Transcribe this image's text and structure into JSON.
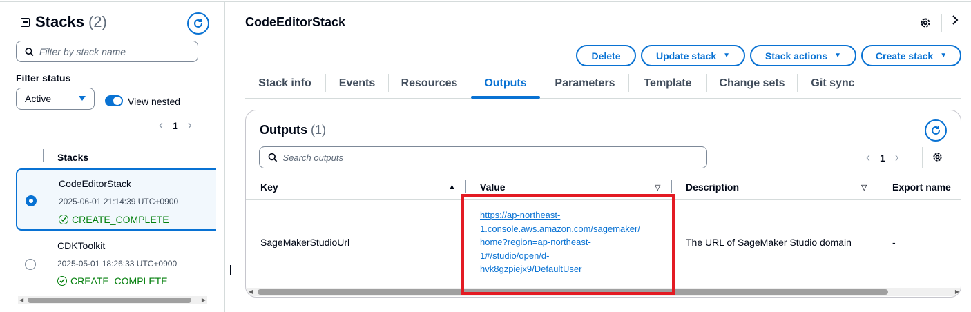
{
  "sidebar": {
    "title": "Stacks",
    "count": "(2)",
    "filter_placeholder": "Filter by stack name",
    "filter_status_label": "Filter status",
    "status_value": "Active",
    "view_nested_label": "View nested",
    "page": "1",
    "column_header": "Stacks",
    "stacks": [
      {
        "name": "CodeEditorStack",
        "date": "2025-06-01 21:14:39 UTC+0900",
        "status": "CREATE_COMPLETE",
        "selected": true
      },
      {
        "name": "CDKToolkit",
        "date": "2025-05-01 18:26:33 UTC+0900",
        "status": "CREATE_COMPLETE",
        "selected": false
      }
    ]
  },
  "main": {
    "title": "CodeEditorStack",
    "buttons": {
      "delete": "Delete",
      "update": "Update stack",
      "actions": "Stack actions",
      "create": "Create stack"
    },
    "tabs": [
      "Stack info",
      "Events",
      "Resources",
      "Outputs",
      "Parameters",
      "Template",
      "Change sets",
      "Git sync"
    ],
    "active_tab": "Outputs",
    "outputs": {
      "title": "Outputs",
      "count": "(1)",
      "search_placeholder": "Search outputs",
      "page": "1",
      "columns": {
        "key": "Key",
        "value": "Value",
        "description": "Description",
        "export": "Export name"
      },
      "rows": [
        {
          "key": "SageMakerStudioUrl",
          "value_lines": [
            "https://ap-northeast-",
            "1.console.aws.amazon.com/sagemaker/",
            "home?region=ap-northeast-",
            "1#/studio/open/d-",
            "hvk8gzpiejx9/DefaultUser"
          ],
          "description": "The URL of SageMaker Studio domain",
          "export_name": "-"
        }
      ]
    }
  },
  "colors": {
    "accent": "#0972d3",
    "success": "#037f0c",
    "highlight": "#e31b23"
  }
}
